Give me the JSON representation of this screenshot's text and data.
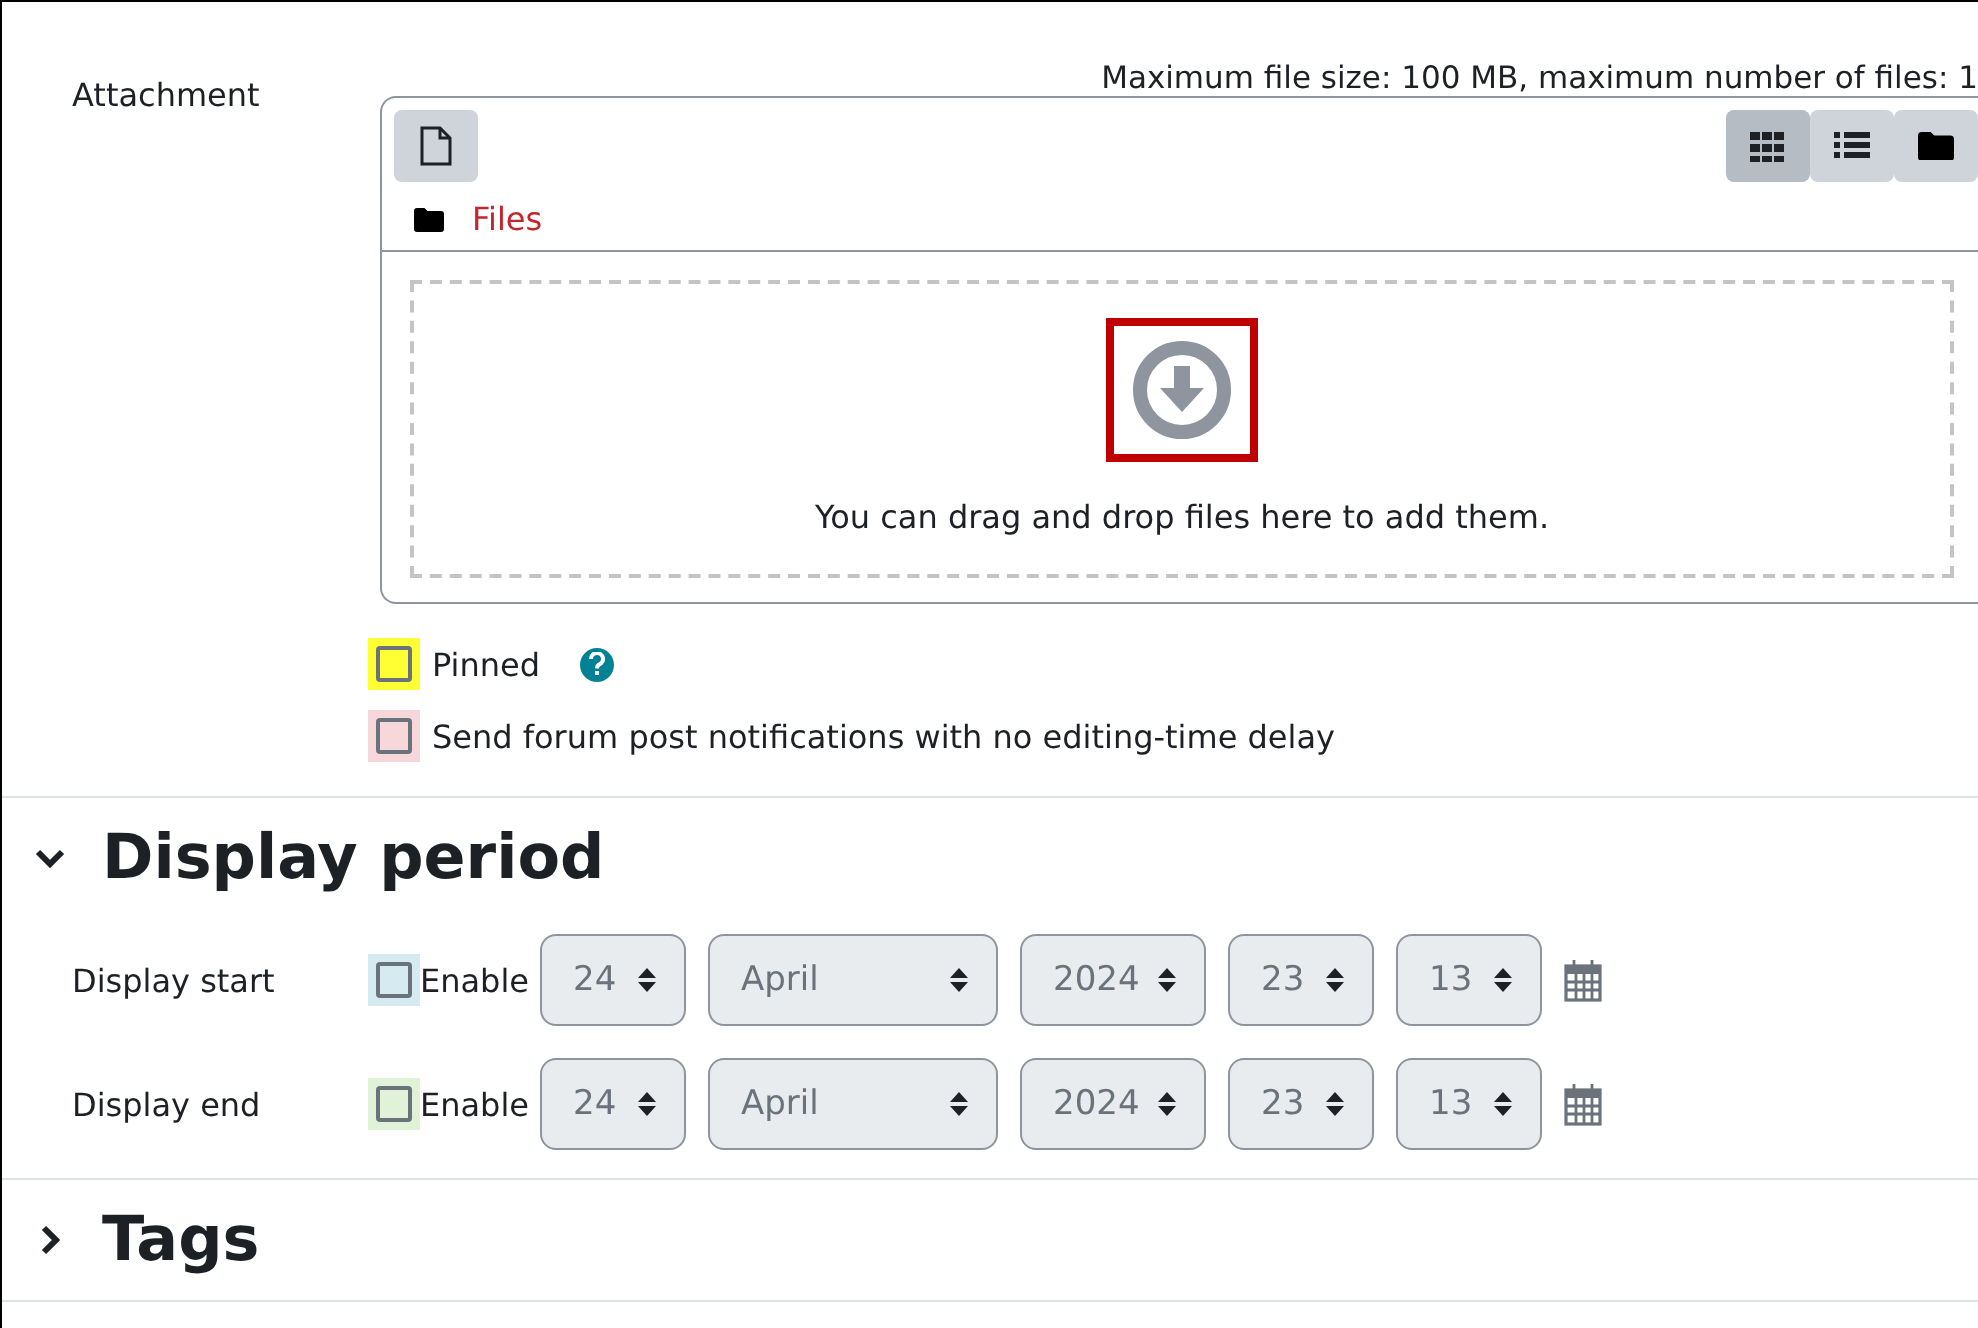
{
  "attachment": {
    "label": "Attachment",
    "limits": "Maximum file size: 100 MB, maximum number of files: 1",
    "views": [
      {
        "kind": "grid",
        "selected": true
      },
      {
        "kind": "list",
        "selected": false
      },
      {
        "kind": "tree",
        "selected": false
      }
    ],
    "path": "Files",
    "drop_text": "You can drag and drop files here to add them.",
    "icon_highlighted": true
  },
  "options": [
    {
      "label": "Pinned",
      "checked": false,
      "color": "#ffff33",
      "help": true
    },
    {
      "label": "Send forum post notifications with no editing-time delay",
      "checked": false,
      "color": "#f8d7da"
    }
  ],
  "sections": [
    {
      "title": "Display period",
      "expanded": true,
      "rows": [
        {
          "label": "Display start",
          "enable": {
            "label": "Enable",
            "checked": false,
            "color": "#d5ebf1"
          },
          "fields": [
            {
              "kind": "day",
              "value": "24"
            },
            {
              "kind": "month",
              "value": "April"
            },
            {
              "kind": "year",
              "value": "2024"
            },
            {
              "kind": "hour",
              "value": "23"
            },
            {
              "kind": "minute",
              "value": "13"
            }
          ]
        },
        {
          "label": "Display end",
          "enable": {
            "label": "Enable",
            "checked": false,
            "color": "#e0f3d8"
          },
          "fields": [
            {
              "kind": "day",
              "value": "24"
            },
            {
              "kind": "month",
              "value": "April"
            },
            {
              "kind": "year",
              "value": "2024"
            },
            {
              "kind": "hour",
              "value": "23"
            },
            {
              "kind": "minute",
              "value": "13"
            }
          ]
        }
      ]
    },
    {
      "title": "Tags",
      "expanded": false
    }
  ]
}
